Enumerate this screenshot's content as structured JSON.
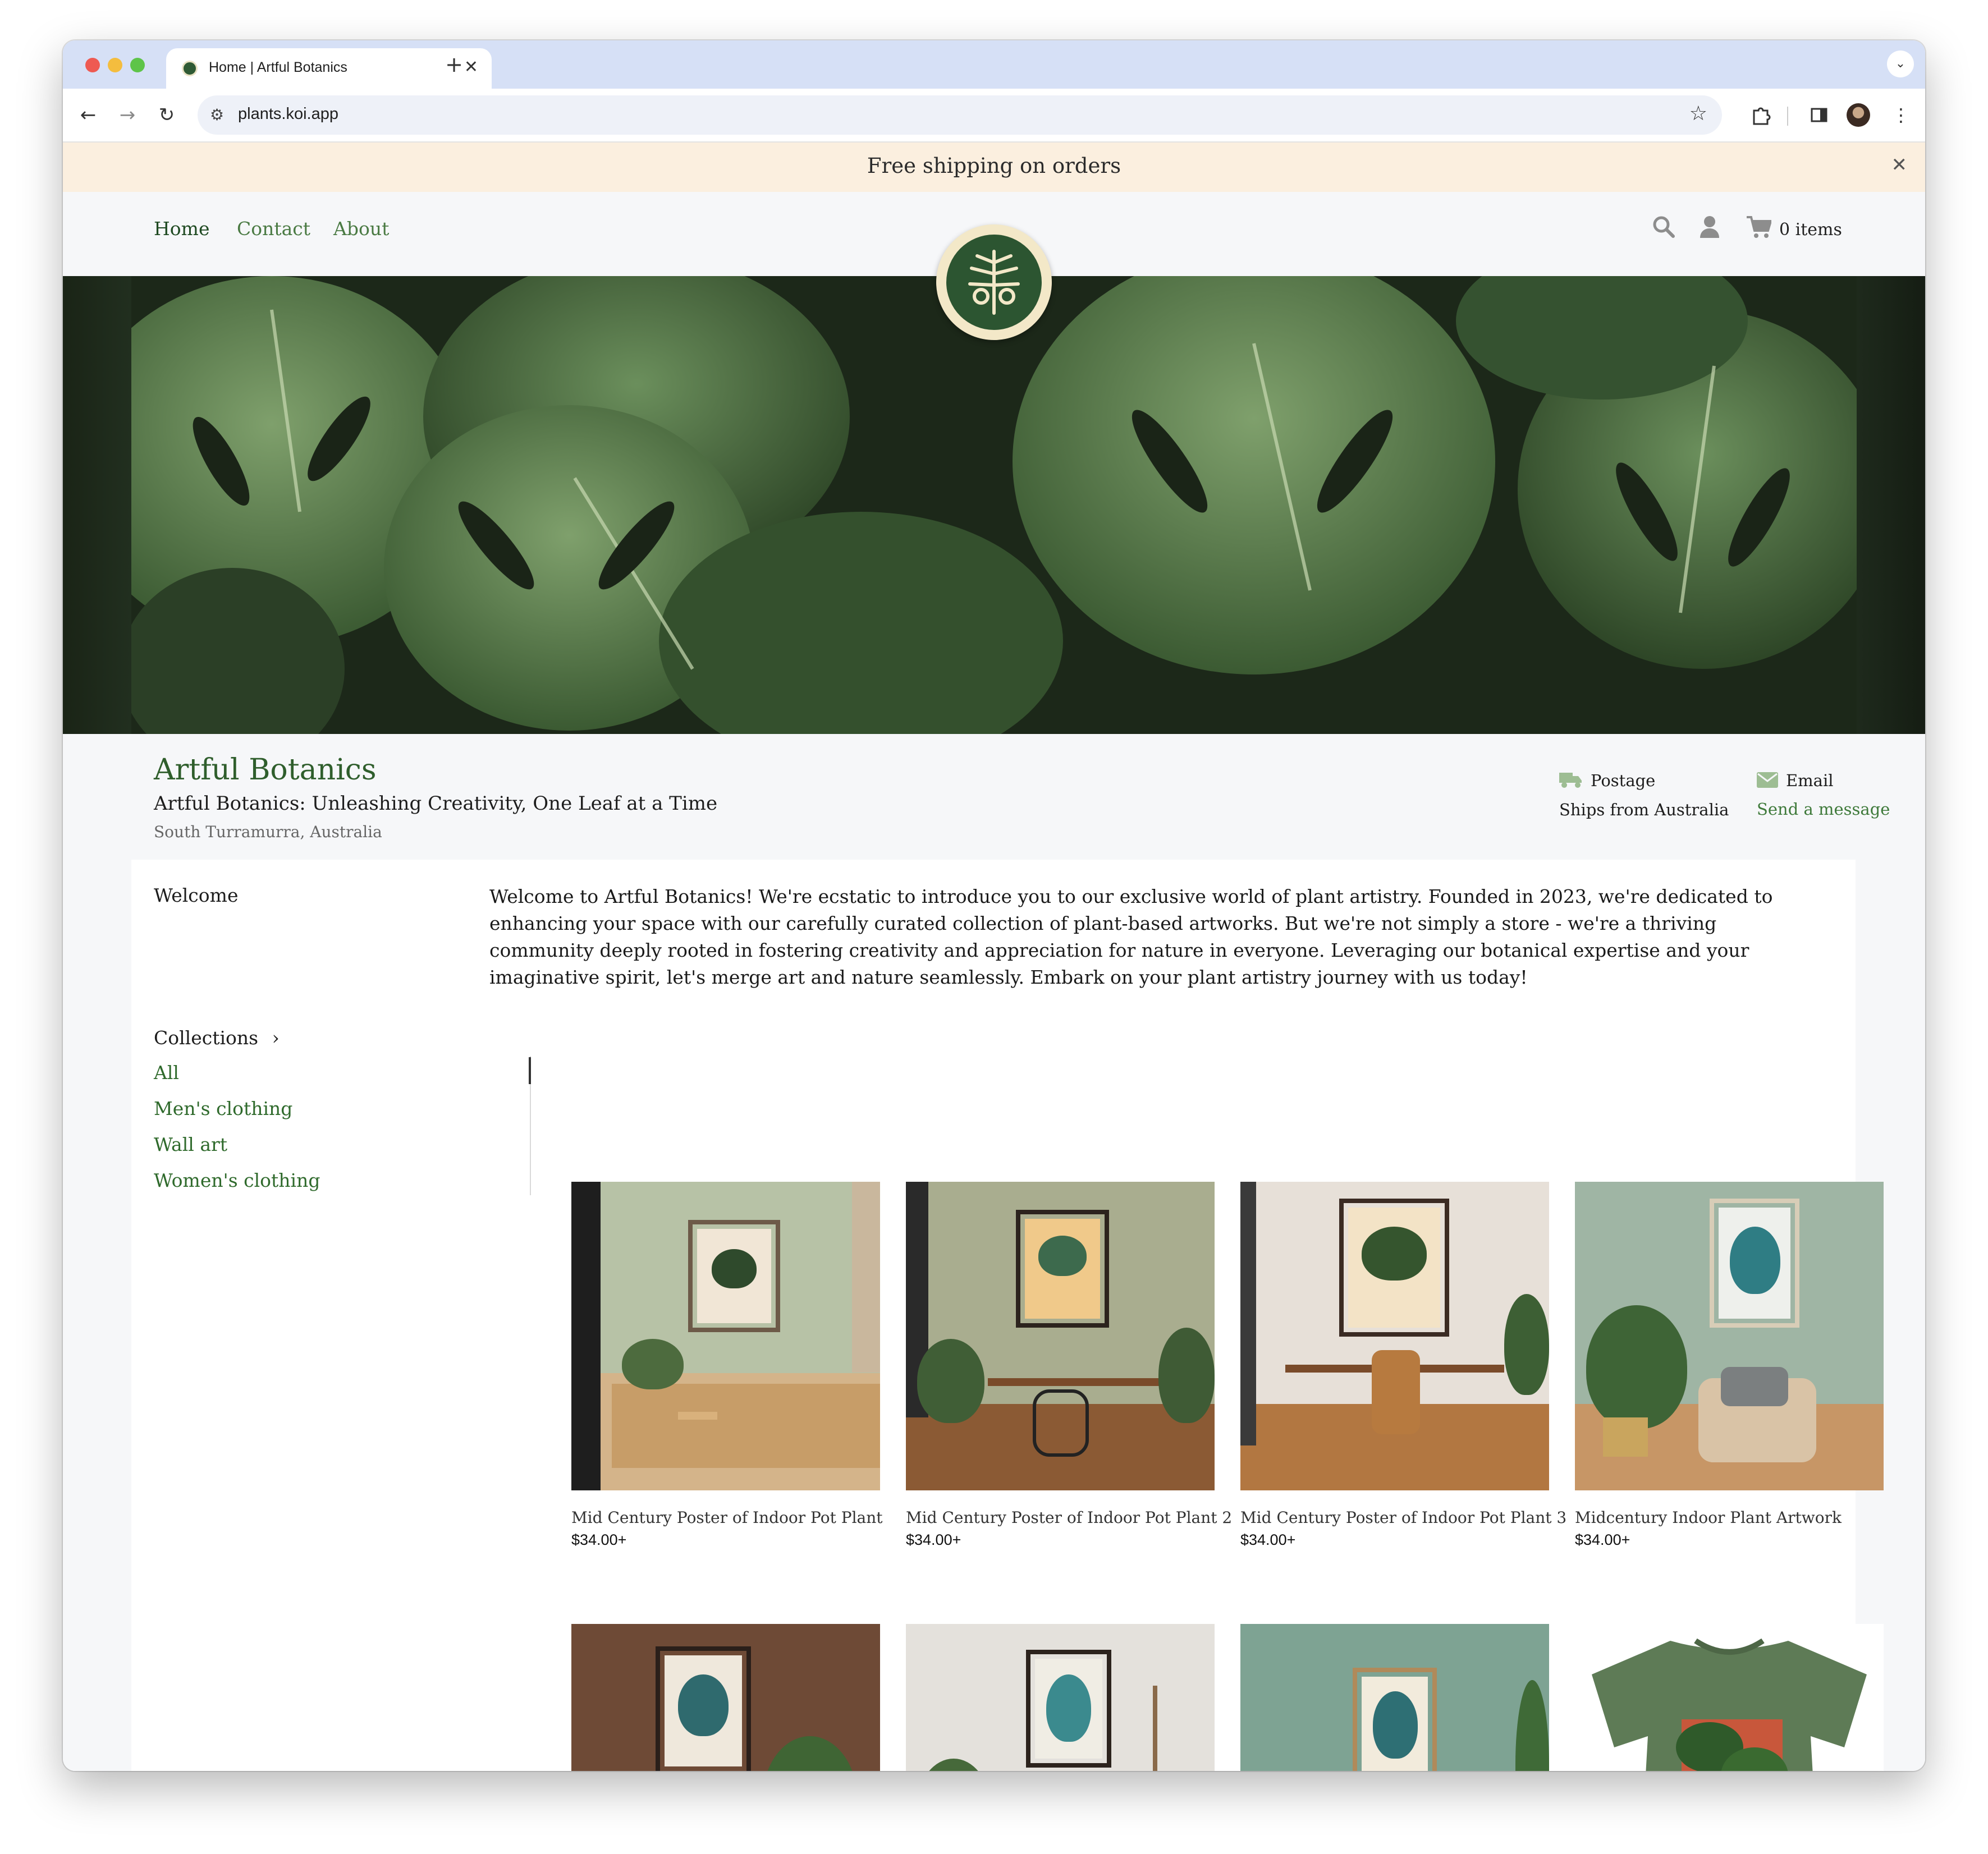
{
  "browser": {
    "tab_title": "Home | Artful Botanics",
    "tab_close": "✕",
    "new_tab": "+",
    "tab_menu": "⌄",
    "url": "plants.koi.app",
    "icons": [
      "back-arrow-icon",
      "forward-arrow-icon",
      "reload-icon",
      "site-settings-icon",
      "bookmark-star-icon",
      "extensions-icon",
      "side-panel-icon",
      "profile-avatar",
      "more-menu-icon"
    ]
  },
  "announcement": {
    "text": "Free shipping on orders",
    "close": "✕"
  },
  "header": {
    "nav": [
      "Home",
      "Contact",
      "About"
    ],
    "cart_label": "0 items"
  },
  "store": {
    "name": "Artful Botanics",
    "tagline": "Artful Botanics: Unleashing Creativity, One Leaf at a Time",
    "location": "South Turramurra, Australia",
    "postage_title": "Postage",
    "postage_detail": "Ships from Australia",
    "email_title": "Email",
    "email_link": "Send a message"
  },
  "welcome": {
    "label": "Welcome",
    "text": "Welcome to Artful Botanics! We're ecstatic to introduce you to our exclusive world of plant artistry. Founded in 2023, we're dedicated to enhancing your space with our carefully curated collection of plant-based artworks. But we're not simply a store - we're a thriving community deeply rooted in fostering creativity and appreciation for nature in everyone. Leveraging our botanical expertise and your imaginative spirit, let's merge art and nature seamlessly. Embark on your plant artistry journey with us today!"
  },
  "collections": {
    "label": "Collections",
    "chevron": "›",
    "items": [
      "All",
      "Men's clothing",
      "Wall art",
      "Women's clothing"
    ]
  },
  "products": [
    {
      "title": "Mid Century Poster of Indoor Pot Plant",
      "price": "$34.00+"
    },
    {
      "title": "Mid Century Poster of Indoor Pot Plant 2",
      "price": "$34.00+"
    },
    {
      "title": "Mid Century Poster of Indoor Pot Plant 3",
      "price": "$34.00+"
    },
    {
      "title": "Midcentury Indoor Plant Artwork",
      "price": "$34.00+"
    },
    {
      "title": "",
      "price": ""
    },
    {
      "title": "",
      "price": ""
    },
    {
      "title": "",
      "price": ""
    },
    {
      "title": "",
      "price": ""
    }
  ],
  "colors": {
    "brand_green": "#2f5e2c",
    "link_green": "#3f7a3b",
    "announcement_bg": "#fbefdf",
    "tabstrip_bg": "#d6e0f6"
  }
}
